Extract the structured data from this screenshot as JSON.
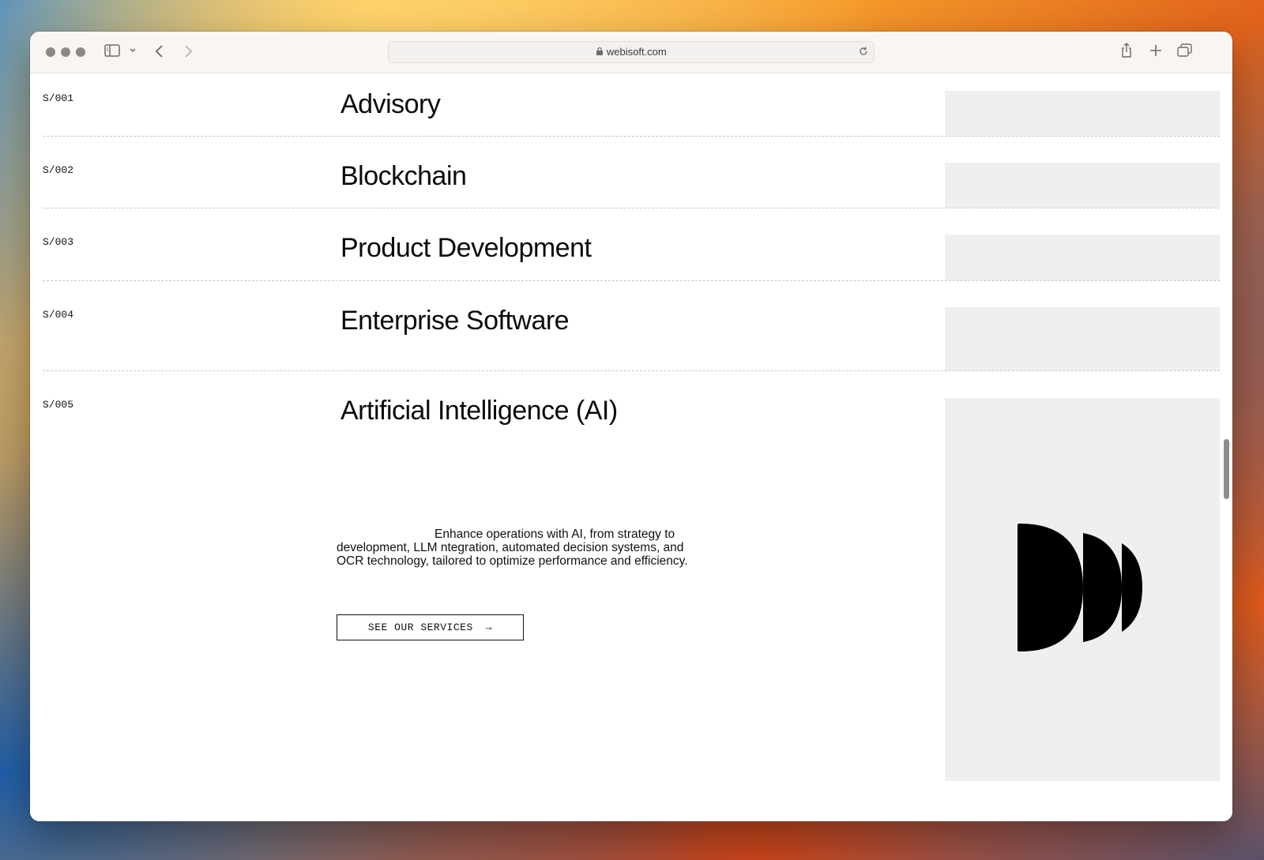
{
  "browser": {
    "url": "webisoft.com"
  },
  "services": [
    {
      "code": "S/001",
      "title": "Advisory"
    },
    {
      "code": "S/002",
      "title": "Blockchain"
    },
    {
      "code": "S/003",
      "title": "Product Development"
    },
    {
      "code": "S/004",
      "title": "Enterprise Software"
    },
    {
      "code": "S/005",
      "title": "Artificial Intelligence (AI)"
    }
  ],
  "active_service": {
    "description_lead": "Enhance operations with AI,  from strategy to",
    "description_rest": "development, LLM ntegration, automated decision systems, and OCR technology, tailored to optimize performance and efficiency.",
    "cta_label": "SEE OUR SERVICES",
    "cta_arrow": "→"
  },
  "colors": {
    "thumb_bg": "#efeff2",
    "text": "#0b0b0b",
    "divider": "#c7c7c9"
  }
}
